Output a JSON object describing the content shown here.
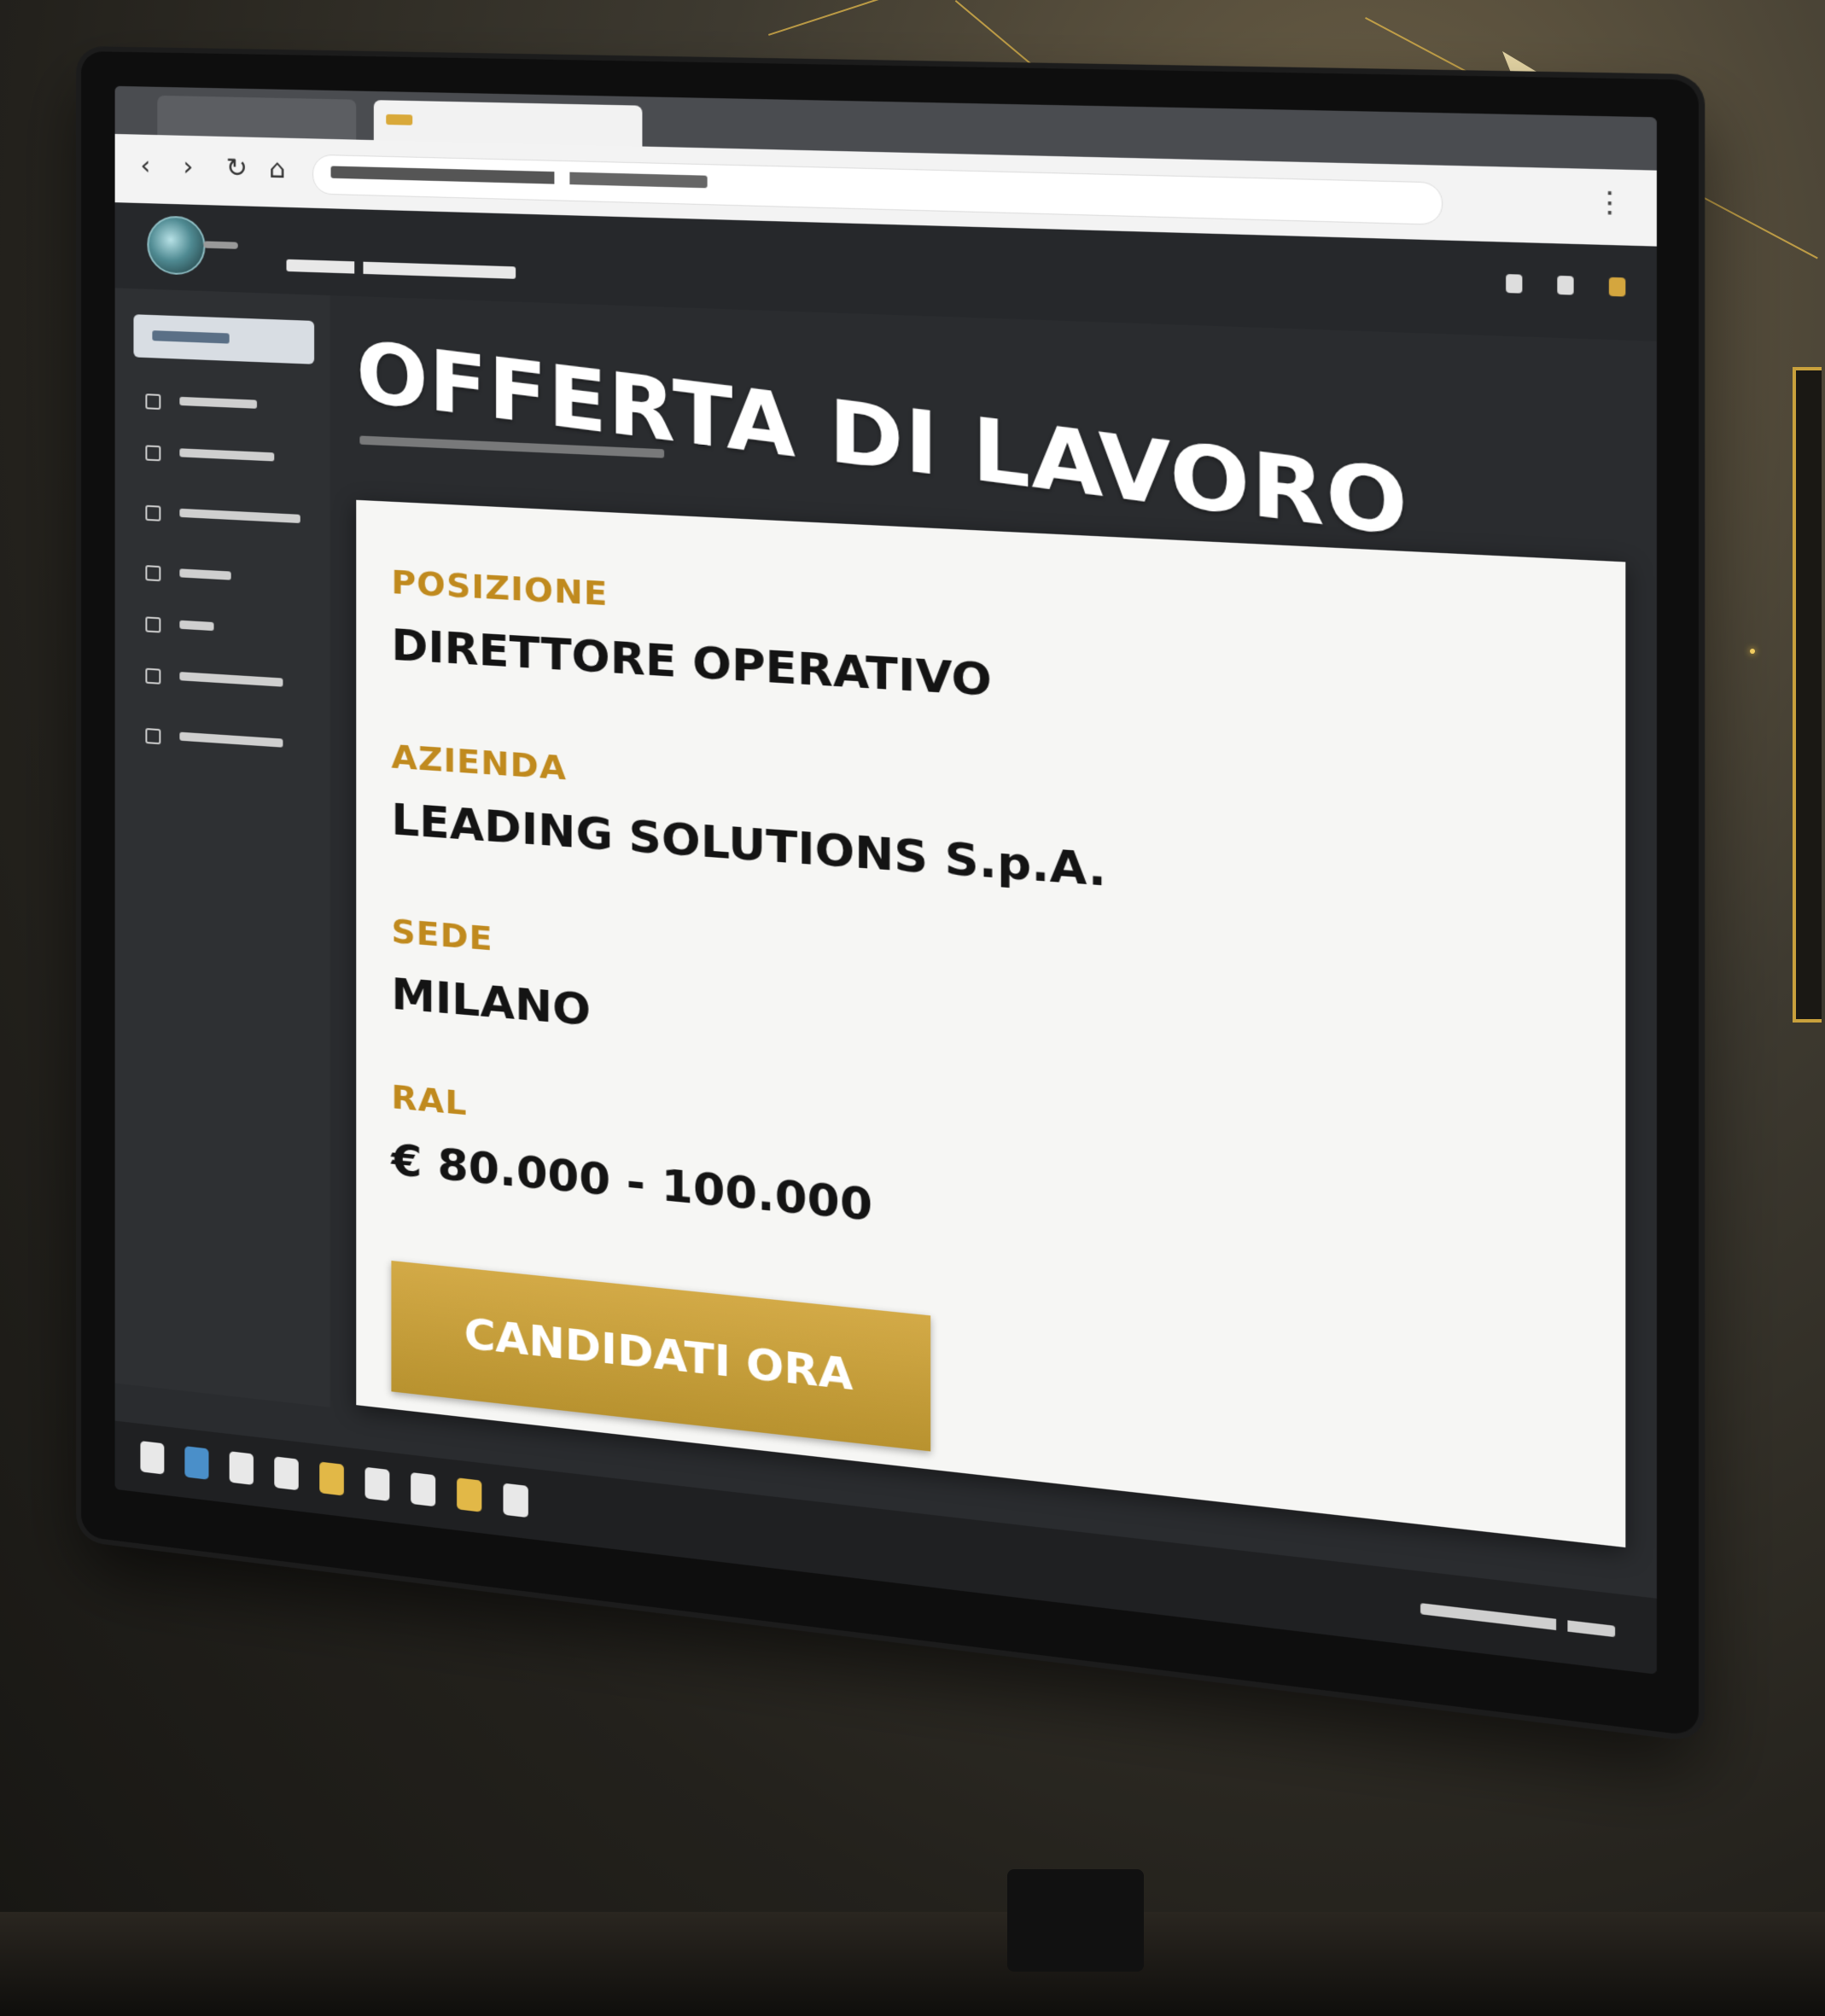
{
  "app": {
    "page_title": "OFFERTA DI LAVORO"
  },
  "job": {
    "position_label": "POSIZIONE",
    "position_value": "DIRETTORE OPERATIVO",
    "company_label": "AZIENDA",
    "company_value": "LEADING SOLUTIONS S.p.A.",
    "location_label": "SEDE",
    "location_value": "MILANO",
    "salary_label": "RAL",
    "salary_value": "€ 80.000 - 100.000",
    "apply_label": "CANDIDATI ORA"
  },
  "colors": {
    "accent_gold": "#c9a13c",
    "screen_bg": "#2a2c2f",
    "card_bg": "#f6f6f4"
  },
  "icons": {
    "browser_nav": [
      "back-icon",
      "forward-icon",
      "reload-icon",
      "home-icon"
    ],
    "browser_menu": "menu-dots-icon",
    "logo": "app-logo-icon"
  }
}
